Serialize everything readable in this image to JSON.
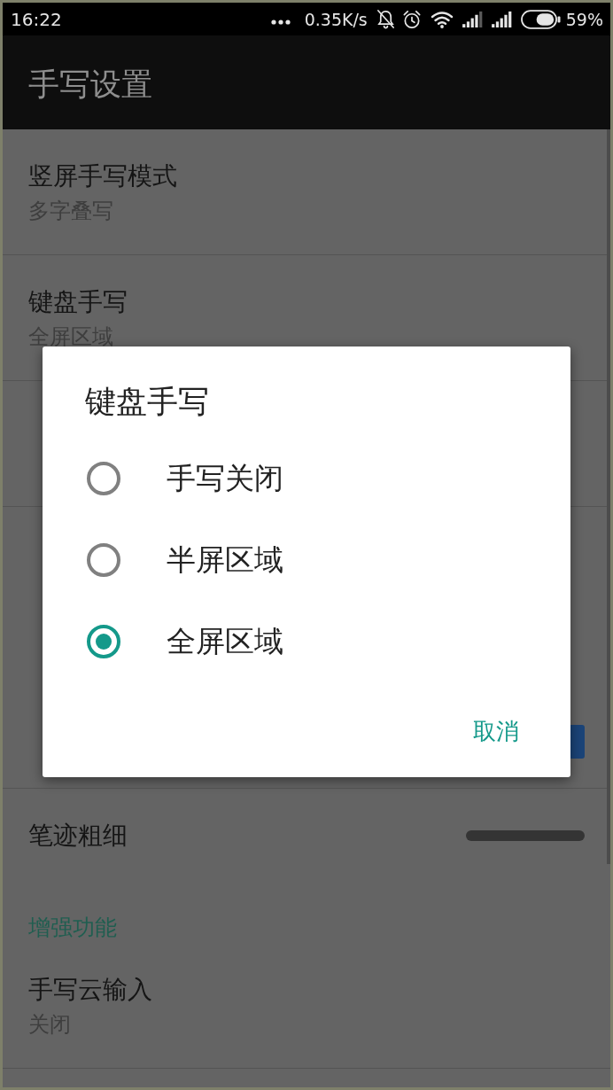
{
  "status_bar": {
    "time": "16:22",
    "network_speed": "0.35K/s",
    "battery": "59%"
  },
  "app_bar": {
    "title": "手写设置"
  },
  "settings": [
    {
      "kind": "item",
      "title": "竖屏手写模式",
      "summary": "多字叠写"
    },
    {
      "kind": "item",
      "title": "键盘手写",
      "summary": "全屏区域"
    },
    {
      "kind": "item"
    },
    {
      "kind": "item"
    },
    {
      "kind": "category"
    },
    {
      "kind": "switch",
      "on": true
    },
    {
      "kind": "stroke",
      "title": "笔迹粗细"
    },
    {
      "kind": "category",
      "title": "增强功能"
    },
    {
      "kind": "item",
      "title": "手写云输入",
      "summary": "关闭"
    }
  ],
  "dialog": {
    "title": "键盘手写",
    "options": [
      {
        "label": "手写关闭",
        "selected": false
      },
      {
        "label": "半屏区域",
        "selected": false
      },
      {
        "label": "全屏区域",
        "selected": true
      }
    ],
    "cancel": "取消"
  }
}
